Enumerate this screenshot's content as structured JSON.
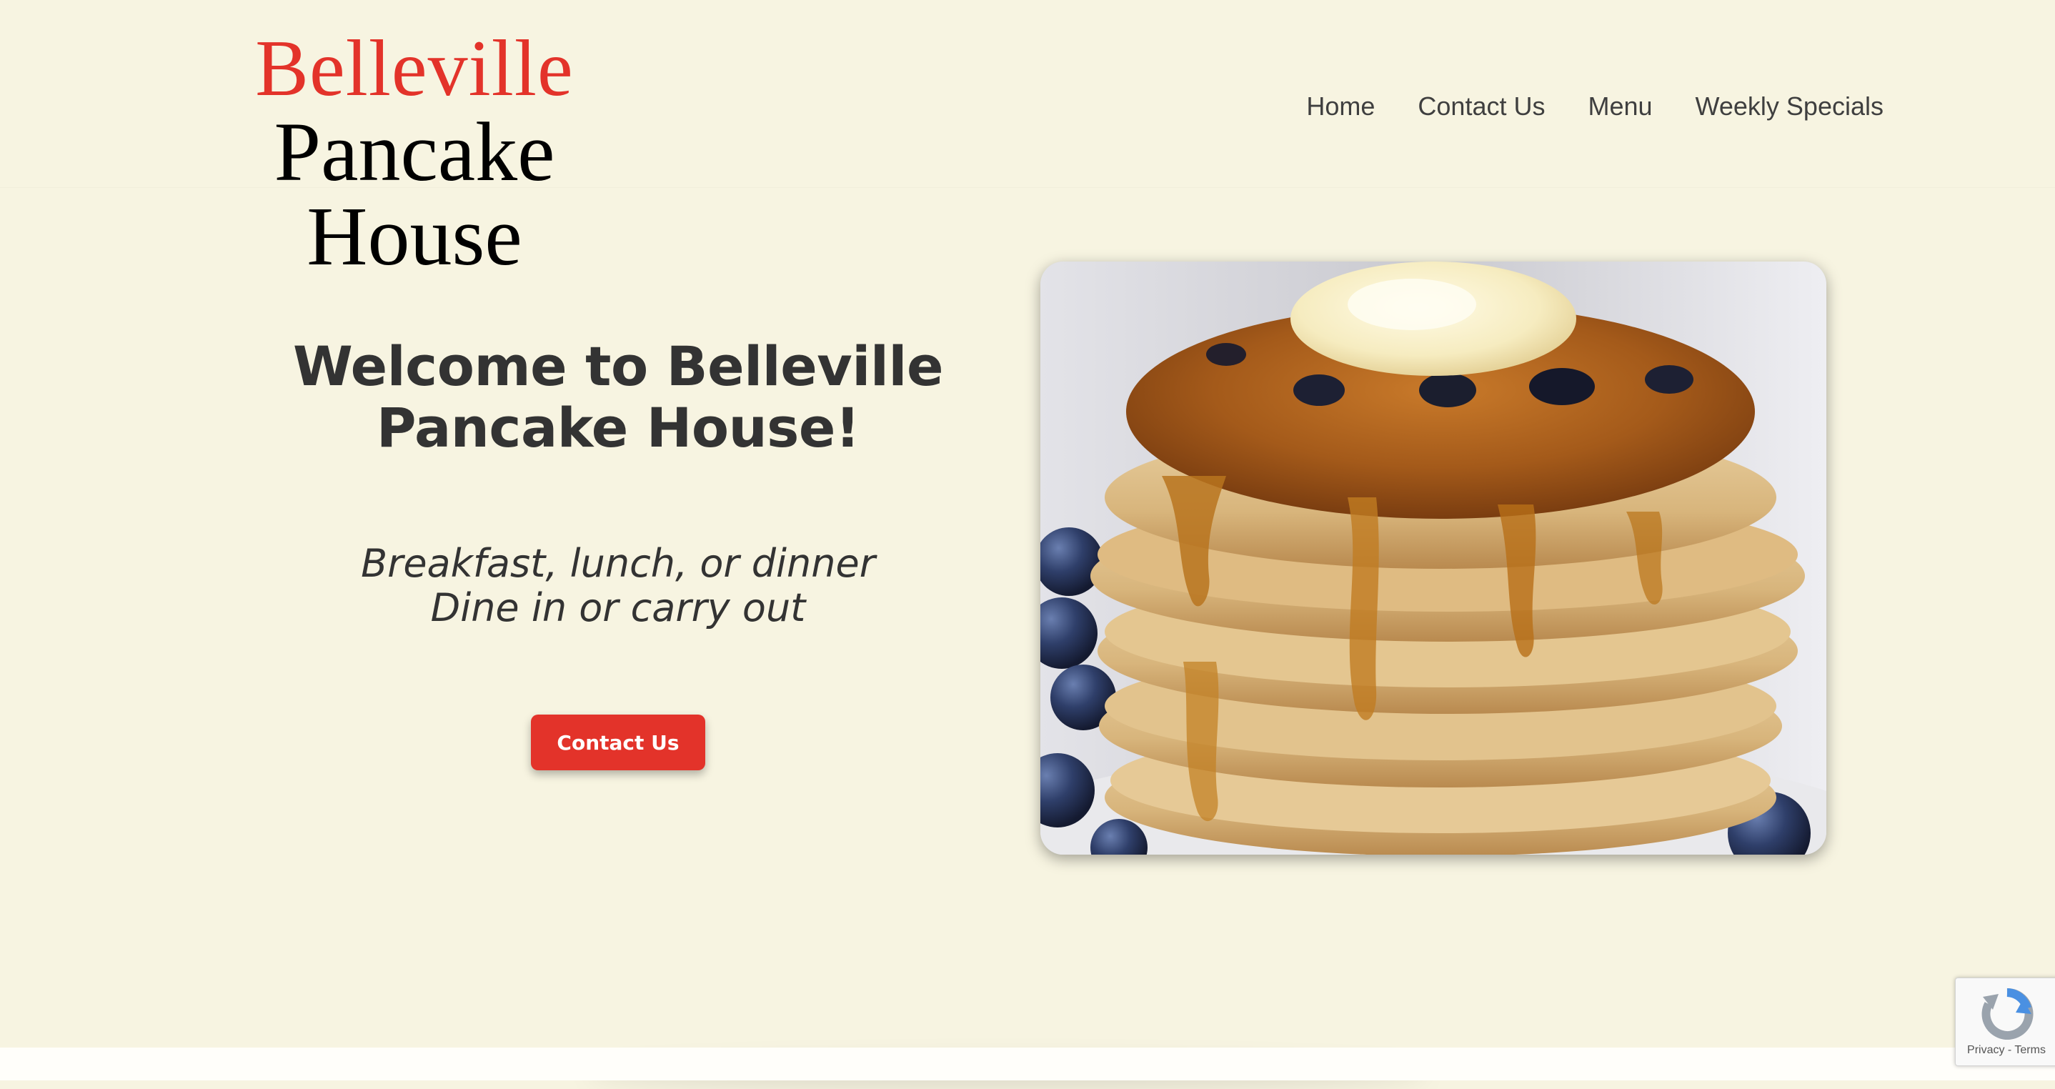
{
  "logo": {
    "line1": "Belleville",
    "line2": "Pancake House"
  },
  "nav": {
    "items": [
      {
        "label": "Home"
      },
      {
        "label": "Contact Us"
      },
      {
        "label": "Menu"
      },
      {
        "label": "Weekly Specials"
      }
    ]
  },
  "hero": {
    "title": "Welcome to Belleville Pancake House!",
    "tagline_line1": "Breakfast, lunch, or dinner",
    "tagline_line2": "Dine in or carry out",
    "cta_label": "Contact Us",
    "image_icon": "pancake-stack-photo"
  },
  "recaptcha": {
    "icon": "recaptcha-icon",
    "privacy": "Privacy",
    "separator": " - ",
    "terms": "Terms"
  },
  "colors": {
    "background": "#f7f4e1",
    "accent_red": "#e3332a",
    "heading_text": "#333333",
    "nav_text": "#3f3f3f"
  }
}
